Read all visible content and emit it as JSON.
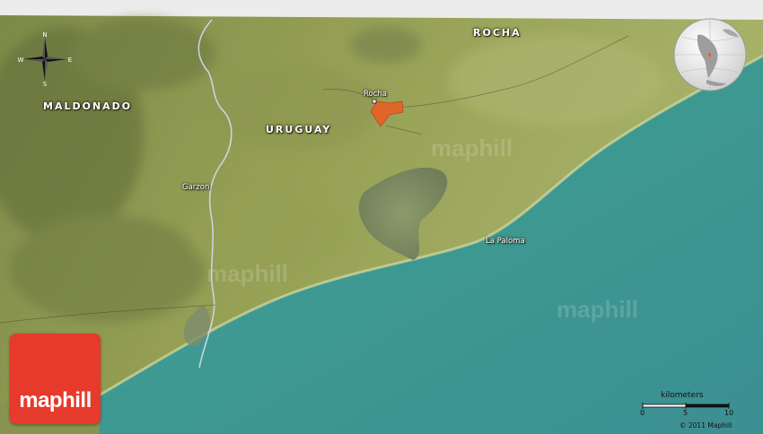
{
  "map": {
    "country_label": "URUGUAY",
    "regions": [
      {
        "name": "ROCHA"
      },
      {
        "name": "MALDONADO"
      }
    ],
    "places": [
      {
        "name": "Rocha"
      },
      {
        "name": "Garzon"
      },
      {
        "name": "La Paloma"
      }
    ],
    "compass": {
      "n": "N",
      "s": "S",
      "e": "E",
      "w": "W"
    },
    "scale": {
      "title": "kilometers",
      "ticks": [
        "0",
        "5",
        "10"
      ]
    },
    "copyright": "© 2011 Maphill",
    "logo": "maphill",
    "watermark": "maphill",
    "colors": {
      "land": "#8f9a52",
      "sea": "#3c9a8e",
      "highlight_area": "#e0662a",
      "logo_red": "#e63a2c",
      "river": "#c9d4de"
    }
  }
}
